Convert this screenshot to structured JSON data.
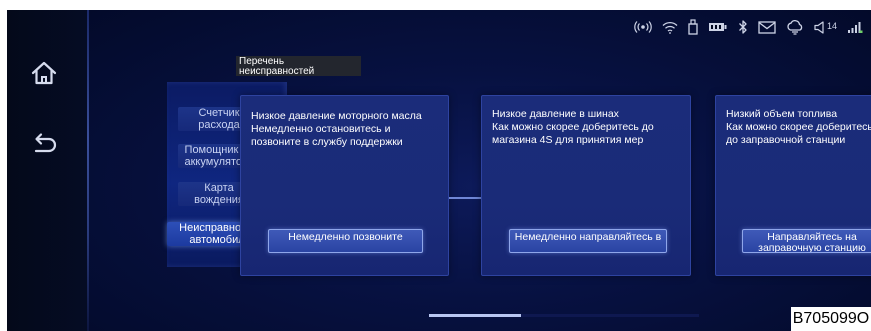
{
  "status_bar": {
    "icons": [
      "radio-signal-icon",
      "wifi-icon",
      "usb-icon",
      "battery-icon",
      "bluetooth-icon",
      "mail-icon",
      "cloud-icon",
      "volume-icon",
      "cellular-signal-icon"
    ],
    "volume_level": "14",
    "accent_color": "#cdd3e6"
  },
  "left_rail": {
    "icons": [
      "home-icon",
      "back-icon"
    ]
  },
  "panel_title": "Перечень неисправностей",
  "menu": {
    "items": [
      {
        "label": "Счетчик расхода",
        "active": false
      },
      {
        "label": "Помощник по аккумулятору",
        "active": false
      },
      {
        "label": "Карта вождения",
        "active": false
      },
      {
        "label": "Неисправност и автомобиля",
        "active": true
      }
    ]
  },
  "cards": [
    {
      "text": "Низкое давление моторного масла\nНемедленно остановитесь и позвоните в службу поддержки",
      "button": "Немедленно позвоните"
    },
    {
      "text": "Низкое давление в шинах\nКак можно скорее доберитесь до магазина 4S для принятия мер",
      "button": "Немедленно направляйтесь в"
    },
    {
      "text": "Низкий объем топлива\nКак можно скорее доберитесь до заправочной станции",
      "button": "Направляйтесь на заправочную станцию"
    }
  ],
  "scroll_position": 0.33,
  "watermark": "B705099O",
  "colors": {
    "background": "#00061e",
    "card": "#1b2c7a",
    "button": "#2a44a3",
    "active_menu": "#2d4fb8"
  }
}
